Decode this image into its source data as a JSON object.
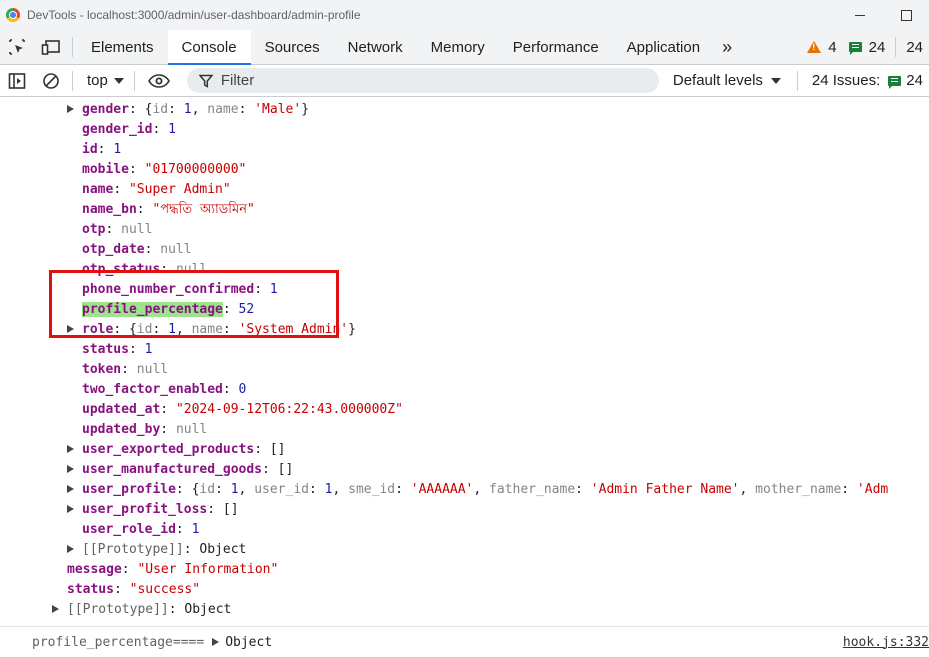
{
  "window": {
    "title": "DevTools - localhost:3000/admin/user-dashboard/admin-profile",
    "min_glyph": "–",
    "max_glyph": "□"
  },
  "tabs": [
    {
      "label": "Elements",
      "active": false
    },
    {
      "label": "Console",
      "active": true
    },
    {
      "label": "Sources",
      "active": false
    },
    {
      "label": "Network",
      "active": false
    },
    {
      "label": "Memory",
      "active": false
    },
    {
      "label": "Performance",
      "active": false
    },
    {
      "label": "Application",
      "active": false
    }
  ],
  "tab_more": "»",
  "counts": {
    "warnings": "4",
    "messages": "24",
    "extra": "24"
  },
  "toolbar": {
    "context": "top",
    "filter_placeholder": "Filter",
    "levels": "Default levels",
    "issues_label": "24 Issues:",
    "issues_count": "24"
  },
  "object": {
    "gender_key": "gender",
    "gender_preview": {
      "open": "{",
      "id_key": "id",
      "id_val": "1",
      "name_key": "name",
      "name_val": "'Male'",
      "close": "}"
    },
    "rows": [
      {
        "key": "gender_id",
        "value": "1",
        "type": "number"
      },
      {
        "key": "id",
        "value": "1",
        "type": "number"
      },
      {
        "key": "mobile",
        "value": "\"01700000000\"",
        "type": "string"
      },
      {
        "key": "name",
        "value": "\"Super Admin\"",
        "type": "string"
      },
      {
        "key": "name_bn",
        "value": "\"পদ্ধতি অ্যাডমিন\"",
        "type": "string"
      },
      {
        "key": "otp",
        "value": "null",
        "type": "null"
      },
      {
        "key": "otp_date",
        "value": "null",
        "type": "null"
      },
      {
        "key": "otp_status",
        "value": "null",
        "type": "null"
      },
      {
        "key": "phone_number_confirmed",
        "value": "1",
        "type": "number"
      },
      {
        "key": "profile_percentage",
        "value": "52",
        "type": "number"
      }
    ],
    "role_key": "role",
    "role_preview": {
      "id_key": "id",
      "id_val": "1",
      "name_key": "name",
      "name_val": "'System Admin'"
    },
    "rows2": [
      {
        "key": "status",
        "value": "1",
        "type": "number"
      },
      {
        "key": "token",
        "value": "null",
        "type": "null"
      },
      {
        "key": "two_factor_enabled",
        "value": "0",
        "type": "number"
      },
      {
        "key": "updated_at",
        "value": "\"2024-09-12T06:22:43.000000Z\"",
        "type": "string"
      },
      {
        "key": "updated_by",
        "value": "null",
        "type": "null"
      }
    ],
    "exported_key": "user_exported_products",
    "exported_val": "[]",
    "manufactured_key": "user_manufactured_goods",
    "manufactured_val": "[]",
    "profile_key": "user_profile",
    "profile_preview": {
      "id_key": "id",
      "id_val": "1",
      "user_id_key": "user_id",
      "user_id_val": "1",
      "sme_id_key": "sme_id",
      "sme_id_val": "'AAAAAA'",
      "father_key": "father_name",
      "father_val": "'Admin Father Name'",
      "mother_key": "mother_name",
      "mother_val": "'Adm"
    },
    "loss_key": "user_profit_loss",
    "loss_val": "[]",
    "role_id_key": "user_role_id",
    "role_id_val": "1",
    "proto_key": "[[Prototype]]",
    "proto_val": "Object"
  },
  "outer": {
    "message_key": "message",
    "message_val": "\"User Information\"",
    "status_key": "status",
    "status_val": "\"success\"",
    "proto_key": "[[Prototype]]",
    "proto_val": "Object"
  },
  "log": {
    "label": "profile_percentage====",
    "object_label": "Object",
    "source": "hook.js:332"
  }
}
